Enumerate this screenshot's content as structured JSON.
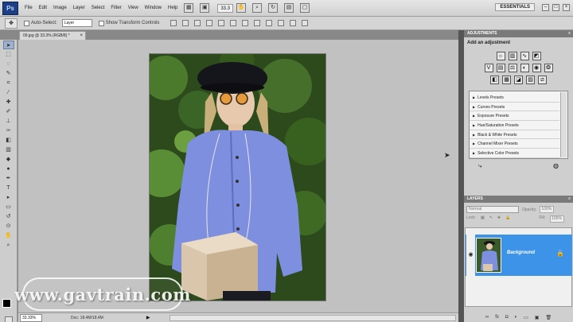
{
  "menubar": {
    "logo": "Ps",
    "items": [
      "File",
      "Edit",
      "Image",
      "Layer",
      "Select",
      "Filter",
      "View",
      "Window",
      "Help"
    ],
    "zoom": "33.3",
    "workspace": "ESSENTIALS"
  },
  "options": {
    "auto_select_label": "Auto-Select:",
    "auto_select_value": "Layer",
    "transform_label": "Show Transform Controls"
  },
  "document": {
    "tab_title": "09.jpg @ 33.3% (RGB/8) *",
    "zoom_readout": "33.33%",
    "doc_size": "Doc: 18.4M/18.4M"
  },
  "adjustments": {
    "header": "ADJUSTMENTS",
    "title": "Add an adjustment",
    "presets": [
      "Levels Presets",
      "Curves Presets",
      "Exposure Presets",
      "Hue/Saturation Presets",
      "Black & White Presets",
      "Channel Mixer Presets",
      "Selective Color Presets"
    ]
  },
  "layers": {
    "header": "LAYERS",
    "blend_mode": "Normal",
    "opacity_label": "Opacity:",
    "opacity_value": "100%",
    "lock_label": "Lock:",
    "fill_label": "Fill:",
    "fill_value": "100%",
    "layer_name": "Background"
  },
  "watermark": "www.gavtrain.com",
  "colors": {
    "layer_selected": "#3d93e8",
    "ps_logo_bg": "#1c3f86"
  }
}
